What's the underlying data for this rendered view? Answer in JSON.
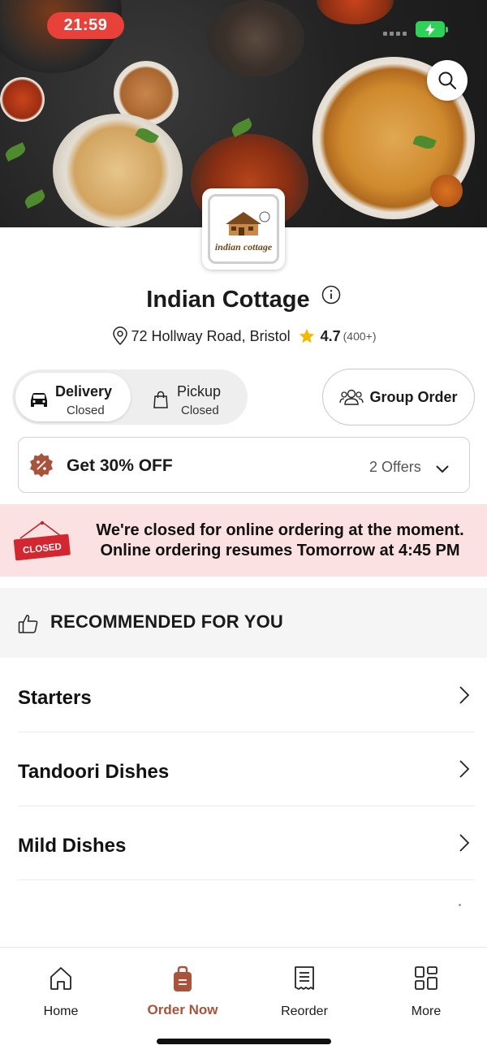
{
  "status_bar": {
    "time": "21:59"
  },
  "restaurant": {
    "name": "Indian Cottage",
    "logo_text": "indian cottage",
    "address": "72 Hollway Road, Bristol",
    "rating": "4.7",
    "rating_count": "(400+)"
  },
  "modes": {
    "delivery": {
      "label": "Delivery",
      "status": "Closed",
      "selected": true
    },
    "pickup": {
      "label": "Pickup",
      "status": "Closed",
      "selected": false
    }
  },
  "group_order": {
    "label": "Group Order"
  },
  "offers": {
    "headline": "Get 30% OFF",
    "count": "2 Offers"
  },
  "closed_banner": {
    "sign": "CLOSED",
    "line1": "We're closed for online ordering at the moment.",
    "line2": "Online ordering resumes Tomorrow at 4:45 PM"
  },
  "recommended": {
    "title": "RECOMMENDED FOR YOU"
  },
  "categories": [
    {
      "label": "Starters"
    },
    {
      "label": "Tandoori Dishes"
    },
    {
      "label": "Mild Dishes"
    }
  ],
  "tabs": [
    {
      "label": "Home",
      "icon": "home-icon"
    },
    {
      "label": "Order Now",
      "icon": "order-bag-icon",
      "active": true
    },
    {
      "label": "Reorder",
      "icon": "receipt-icon"
    },
    {
      "label": "More",
      "icon": "grid-icon"
    }
  ],
  "colors": {
    "accent": "#a8533c",
    "time_pill": "#e8413a",
    "closed_banner_bg": "#fbe1e1",
    "star": "#f5b800",
    "battery": "#2fd158"
  }
}
